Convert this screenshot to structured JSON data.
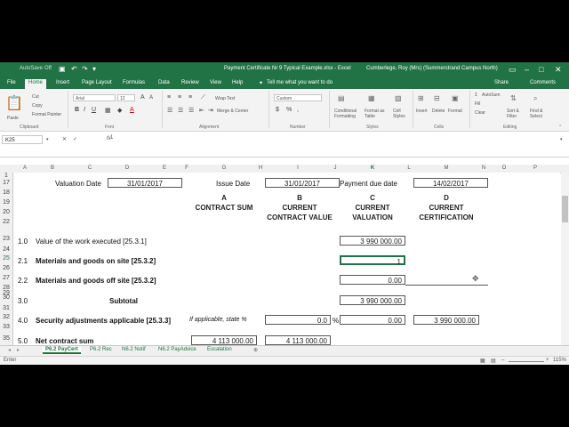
{
  "title_bar": {
    "autosave": "AutoSave",
    "autosave_state": "Off",
    "document_title": "Payment Certificate Nr 9  Typical Example.xlsx  -  Excel",
    "user": "Cumberlege, Roy (Mrs) (Summerstrand Campus North)"
  },
  "ribbon_tabs": [
    "File",
    "Home",
    "Insert",
    "Page Layout",
    "Formulas",
    "Data",
    "Review",
    "View",
    "Help"
  ],
  "tell_me": "Tell me what you want to do",
  "share": "Share",
  "comments": "Comments",
  "ribbon": {
    "paste": "Paste",
    "cut": "Cut",
    "copy": "Copy",
    "format_painter": "Format Painter",
    "clipboard": "Clipboard",
    "font_name": "Arial",
    "font_size": "12",
    "font_group": "Font",
    "wrap_text": "Wrap Text",
    "merge_center": "Merge & Center",
    "alignment": "Alignment",
    "number_format": "Custom",
    "number": "Number",
    "conditional": "Conditional Formatting",
    "format_as_table": "Format as Table",
    "cell_styles": "Cell Styles",
    "styles": "Styles",
    "insert": "Insert",
    "delete": "Delete",
    "format": "Format",
    "cells": "Cells",
    "autosum": "AutoSum",
    "fill": "Fill",
    "clear": "Clear",
    "sort_filter": "Sort & Filter",
    "find_select": "Find & Select",
    "editing": "Editing"
  },
  "formula_bar": {
    "name_box": "K25",
    "fx": "fx",
    "content": "1"
  },
  "columns": [
    "A",
    "B",
    "C",
    "D",
    "E",
    "F",
    "G",
    "H",
    "I",
    "J",
    "K",
    "L",
    "M",
    "N",
    "O",
    "P"
  ],
  "rows": [
    "1",
    "17",
    "18",
    "19",
    "20",
    "22",
    "23",
    "24",
    "25",
    "26",
    "27",
    "28",
    "29",
    "30",
    "31",
    "32",
    "33",
    "35"
  ],
  "sheet": {
    "valuation_date_label": "Valuation Date",
    "valuation_date": "31/01/2017",
    "issue_date_label": "Issue Date",
    "issue_date": "31/01/2017",
    "payment_due_label": "Payment due date",
    "payment_due": "14/02/2017",
    "col_a_letter": "A",
    "col_a_title": "CONTRACT SUM",
    "col_b_letter": "B",
    "col_b_title1": "CURRENT",
    "col_b_title2": "CONTRACT VALUE",
    "col_c_letter": "C",
    "col_c_title1": "CURRENT",
    "col_c_title2": "VALUATION",
    "col_d_letter": "D",
    "col_d_title1": "CURRENT",
    "col_d_title2": "CERTIFICATION",
    "r1_num": "1.0",
    "r1_label": "Value of the work executed [25.3.1]",
    "r1_c": "3 990 000.00",
    "r21_num": "2.1",
    "r21_label": "Materials and goods on site [25.3.2]",
    "r21_c": "1",
    "r22_num": "2.2",
    "r22_label": "Materials and goods off site [25.3.2]",
    "r22_c": "0.00",
    "r3_num": "3.0",
    "r3_label": "Subtotal",
    "r3_c": "3 990 000.00",
    "r4_num": "4.0",
    "r4_label": "Security adjustments applicable [25.3.3]",
    "r4_note": "If applicable, state %",
    "r4_b": "0.0",
    "r4_pct": "%",
    "r4_c": "0.00",
    "r4_d": "3 990 000.00",
    "r5_num": "5.0",
    "r5_label": "Net contract sum",
    "r5_a": "4 113 000.00",
    "r5_b": "4 113 000.00"
  },
  "sheet_tabs": [
    "P6.2 PayCert",
    "P6.2 Rec",
    "N6.2 Notif",
    "N6.2 PayAdvice",
    "Escalation"
  ],
  "status": {
    "mode": "Enter",
    "zoom": "115%"
  }
}
